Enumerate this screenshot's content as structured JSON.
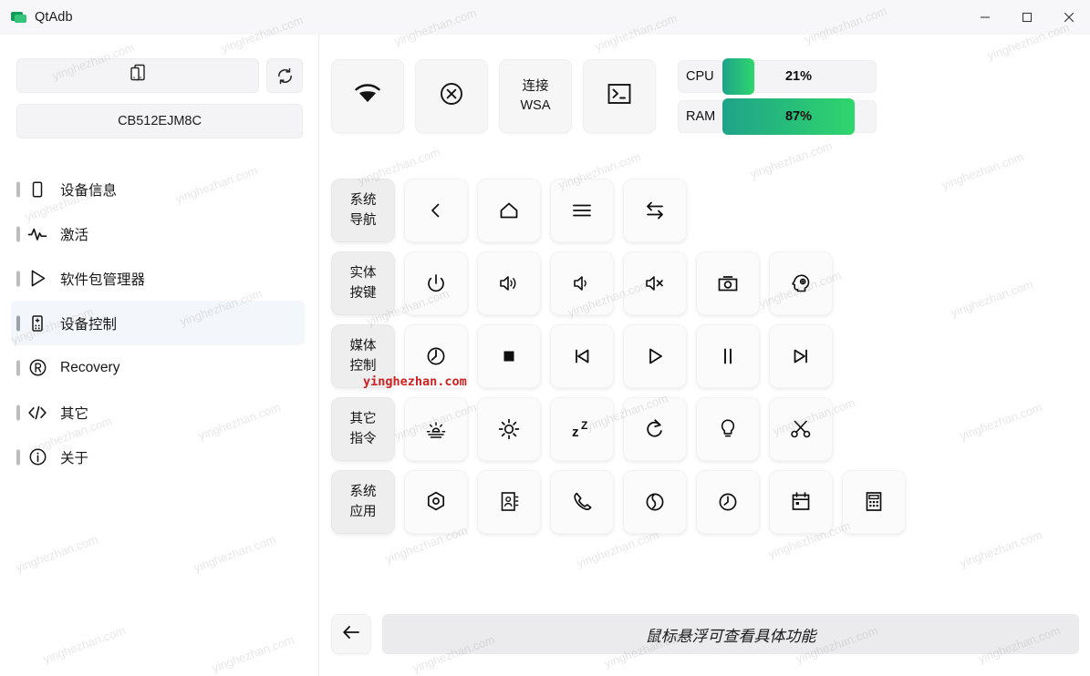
{
  "window": {
    "title": "QtAdb",
    "logo_icon": "qtadb-logo-icon",
    "minimize_icon": "minimize-icon",
    "maximize_icon": "maximize-icon",
    "close_icon": "close-icon"
  },
  "sidebar": {
    "device_select": {
      "icon": "devices-icon",
      "value": ""
    },
    "refresh": {
      "icon": "refresh-icon",
      "label": ""
    },
    "serial": "CB512EJM8C",
    "items": [
      {
        "label": "设备信息",
        "icon": "phone-icon",
        "active": false
      },
      {
        "label": "激活",
        "icon": "pulse-icon",
        "active": false
      },
      {
        "label": "软件包管理器",
        "icon": "play-store-icon",
        "active": false
      },
      {
        "label": "设备控制",
        "icon": "remote-control-icon",
        "active": true
      },
      {
        "label": "Recovery",
        "icon": "registered-r-icon",
        "active": false
      },
      {
        "label": "其它",
        "icon": "code-brackets-icon",
        "active": false
      },
      {
        "label": "关于",
        "icon": "info-circle-icon",
        "active": false
      }
    ]
  },
  "toolbar": {
    "buttons": [
      {
        "label": "",
        "icon": "wifi-icon",
        "name": "wifi-connect-button"
      },
      {
        "label": "",
        "icon": "disconnect-circle-x-icon",
        "name": "disconnect-button"
      },
      {
        "label": "连接\nWSA",
        "line1": "连接",
        "line2": "WSA",
        "icon": "",
        "name": "connect-wsa-button"
      },
      {
        "label": "",
        "icon": "terminal-icon",
        "name": "terminal-button"
      }
    ],
    "meters": [
      {
        "label": "CPU",
        "value": "21%",
        "percent": 21
      },
      {
        "label": "RAM",
        "value": "87%",
        "percent": 87
      }
    ],
    "meter_gradient_start": "#1fa389",
    "meter_gradient_end": "#2fd66d"
  },
  "grid": {
    "rows": [
      {
        "group_line1": "系统",
        "group_line2": "导航",
        "cells": [
          {
            "icon": "chevron-left-icon",
            "name": "nav-back-button"
          },
          {
            "icon": "home-icon",
            "name": "nav-home-button"
          },
          {
            "icon": "menu-icon",
            "name": "nav-menu-button"
          },
          {
            "icon": "app-switch-icon",
            "name": "nav-app-switch-button"
          }
        ]
      },
      {
        "group_line1": "实体",
        "group_line2": "按键",
        "cells": [
          {
            "icon": "power-icon",
            "name": "key-power-button"
          },
          {
            "icon": "volume-up-icon",
            "name": "key-volume-up-button"
          },
          {
            "icon": "volume-down-icon",
            "name": "key-volume-down-button"
          },
          {
            "icon": "volume-mute-icon",
            "name": "key-mute-button"
          },
          {
            "icon": "camera-icon",
            "name": "key-camera-button"
          },
          {
            "icon": "assistant-head-icon",
            "name": "key-assistant-button"
          }
        ]
      },
      {
        "group_line1": "媒体",
        "group_line2": "控制",
        "cells": [
          {
            "icon": "media-power-icon",
            "name": "media-power-button"
          },
          {
            "icon": "stop-icon",
            "name": "media-stop-button"
          },
          {
            "icon": "previous-track-icon",
            "name": "media-previous-button"
          },
          {
            "icon": "play-icon",
            "name": "media-play-button"
          },
          {
            "icon": "pause-icon",
            "name": "media-pause-button"
          },
          {
            "icon": "next-track-icon",
            "name": "media-next-button"
          }
        ]
      },
      {
        "group_line1": "其它",
        "group_line2": "指令",
        "cells": [
          {
            "icon": "brightness-low-icon",
            "name": "cmd-brightness-down-button"
          },
          {
            "icon": "brightness-high-icon",
            "name": "cmd-brightness-up-button"
          },
          {
            "icon": "sleep-zz-icon",
            "name": "cmd-sleep-button"
          },
          {
            "icon": "wake-refresh-icon",
            "name": "cmd-wake-button"
          },
          {
            "icon": "lightbulb-icon",
            "name": "cmd-flashlight-button"
          },
          {
            "icon": "scissors-icon",
            "name": "cmd-screenshot-cut-button"
          }
        ]
      },
      {
        "group_line1": "系统",
        "group_line2": "应用",
        "cells": [
          {
            "icon": "settings-gear-icon",
            "name": "app-settings-button"
          },
          {
            "icon": "contacts-icon",
            "name": "app-contacts-button"
          },
          {
            "icon": "phone-handset-icon",
            "name": "app-dialer-button"
          },
          {
            "icon": "browser-globe-icon",
            "name": "app-browser-button"
          },
          {
            "icon": "clock-icon",
            "name": "app-clock-button"
          },
          {
            "icon": "calendar-icon",
            "name": "app-calendar-button"
          },
          {
            "icon": "calculator-icon",
            "name": "app-calculator-button"
          }
        ]
      }
    ]
  },
  "bottom": {
    "back_icon": "arrow-left-icon",
    "hint": "鼠标悬浮可查看具体功能"
  },
  "watermarks": {
    "text": "yinghezhan.com",
    "faint": "yinghezhan.com",
    "red_color": "#cc2222"
  }
}
